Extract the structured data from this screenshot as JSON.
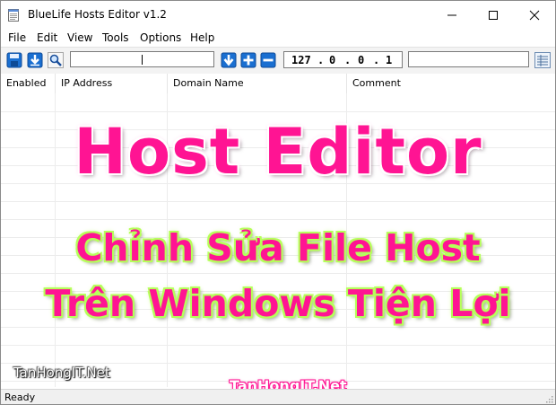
{
  "window": {
    "title": "BlueLife Hosts Editor v1.2",
    "controls": {
      "minimize": "minimize-icon",
      "maximize": "maximize-icon",
      "close": "close-icon"
    }
  },
  "menu": {
    "items": [
      {
        "label": "File"
      },
      {
        "label": "Edit"
      },
      {
        "label": "View"
      },
      {
        "label": "Tools"
      },
      {
        "label": "Options"
      },
      {
        "label": "Help"
      }
    ]
  },
  "toolbar": {
    "icons": [
      "save-icon",
      "download-icon",
      "search-icon",
      "down-arrow-icon",
      "add-icon",
      "remove-icon",
      "list-view-icon"
    ],
    "search_value": "",
    "ip_address": [
      "127",
      "0",
      "0",
      "1"
    ],
    "domain_value": ""
  },
  "grid": {
    "columns": [
      {
        "label": "Enabled"
      },
      {
        "label": "IP Address"
      },
      {
        "label": "Domain Name"
      },
      {
        "label": "Comment"
      }
    ],
    "rows": []
  },
  "overlay": {
    "headline": "Host Editor",
    "line1": "Chỉnh Sửa File Host",
    "line2": "Trên Windows Tiện Lợi",
    "watermark_left": "TanHongIT.Net",
    "watermark_center": "TanHongIT.Net",
    "colors": {
      "headline": "#ff1493",
      "glow_green": "#b6ff5a",
      "glow_pink": "#ffb6e0"
    }
  },
  "status": {
    "text": "Ready"
  }
}
